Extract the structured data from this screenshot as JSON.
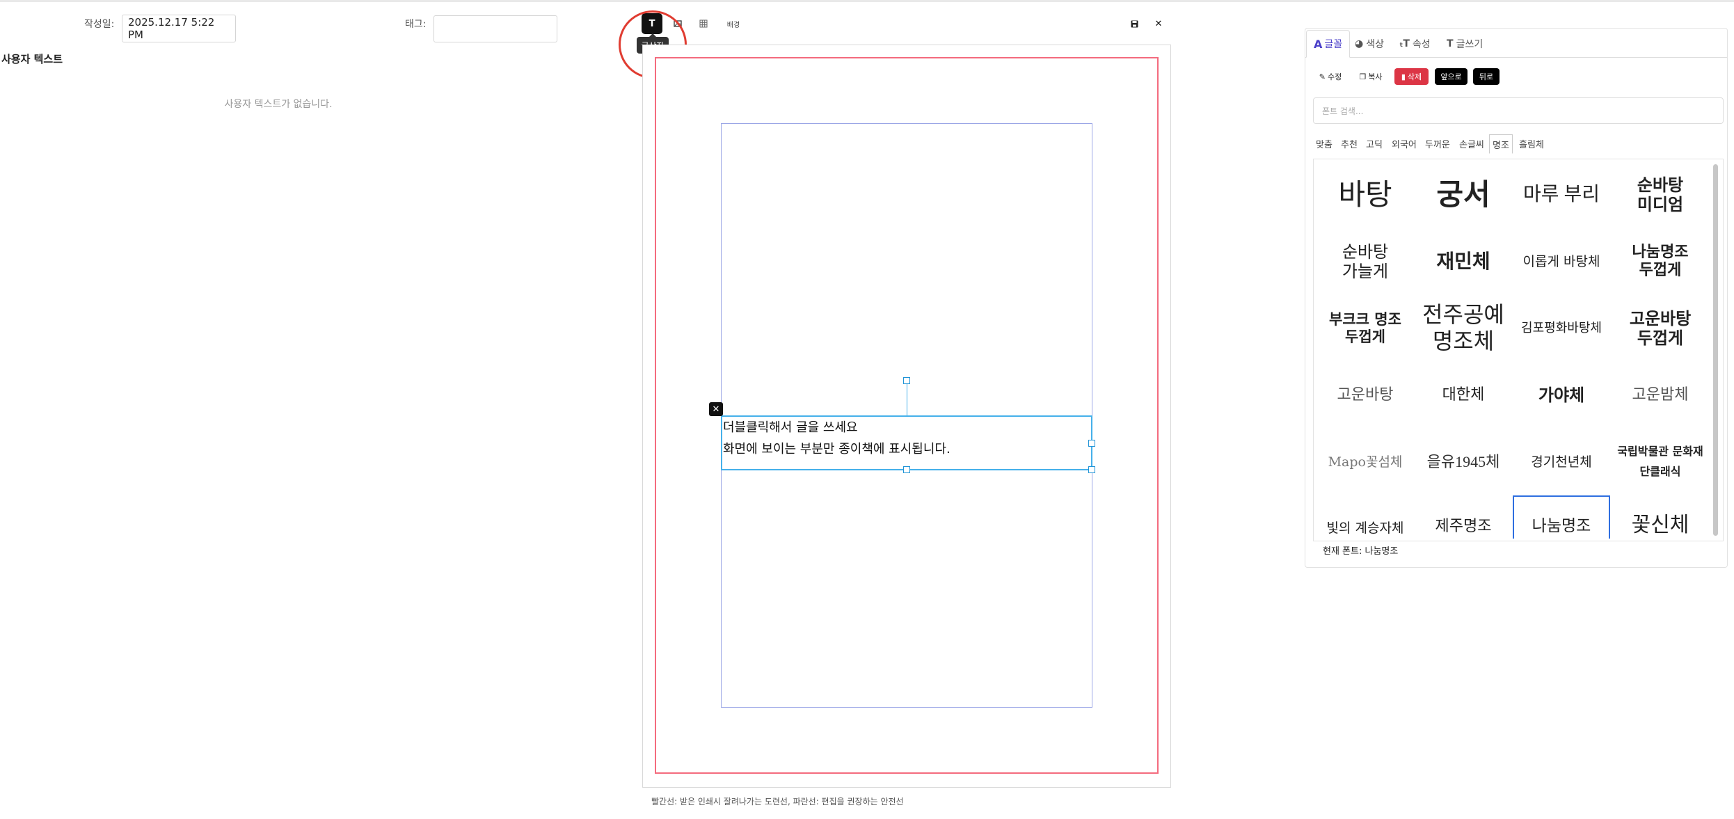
{
  "meta": {
    "date_label": "작성일:",
    "date_value": "2025.12.17 5:22 PM",
    "tag_label": "태그:",
    "tag_value": ""
  },
  "user_text": {
    "title": "사용자 텍스트",
    "empty": "사용자 텍스트가 없습니다."
  },
  "toolbar": {
    "text_tool": "T",
    "tooltip": "글상자",
    "bg_label": "배경",
    "save_icon": "save-icon",
    "close": "✕"
  },
  "canvas": {
    "line1": "더블클릭해서 글을 쓰세요",
    "line2": "화면에 보이는 부분만 종이책에 표시됩니다.",
    "legend": "빨간선: 받은 인쇄시 잘려나가는 도련선, 파란선: 편집을 권장하는 안전선"
  },
  "panel": {
    "tabs": [
      {
        "icon": "A",
        "label": "글꼴"
      },
      {
        "icon": "◕",
        "label": "색상"
      },
      {
        "icon": "ₜT",
        "label": "속성"
      },
      {
        "icon": "T",
        "label": "글쓰기"
      }
    ],
    "actions": {
      "edit": "수정",
      "copy": "복사",
      "delete": "삭제",
      "front": "앞으로",
      "back": "뒤로"
    },
    "search_placeholder": "폰트 검색...",
    "categories": [
      "맞춤",
      "추천",
      "고딕",
      "외국어",
      "두꺼운",
      "손글씨",
      "명조",
      "흘림체"
    ],
    "fonts": [
      "바탕",
      "궁서",
      "마루 부리",
      "순바탕 미디엄",
      "순바탕 가늘게",
      "재민체",
      "이롭게 바탕체",
      "나눔명조 두껍게",
      "부크크 명조 두껍게",
      "전주공예 명조체",
      "김포평화바탕체",
      "고운바탕 두껍게",
      "고운바탕",
      "대한체",
      "가야체",
      "고운밤체",
      "Mapo꽃섬체",
      "을유1945체",
      "경기천년체",
      "국립박물관 문화재단클래식",
      "빛의 계승자체",
      "제주명조",
      "나눔명조",
      "꽃신체"
    ],
    "current_font": "현재 폰트: 나눔명조"
  }
}
